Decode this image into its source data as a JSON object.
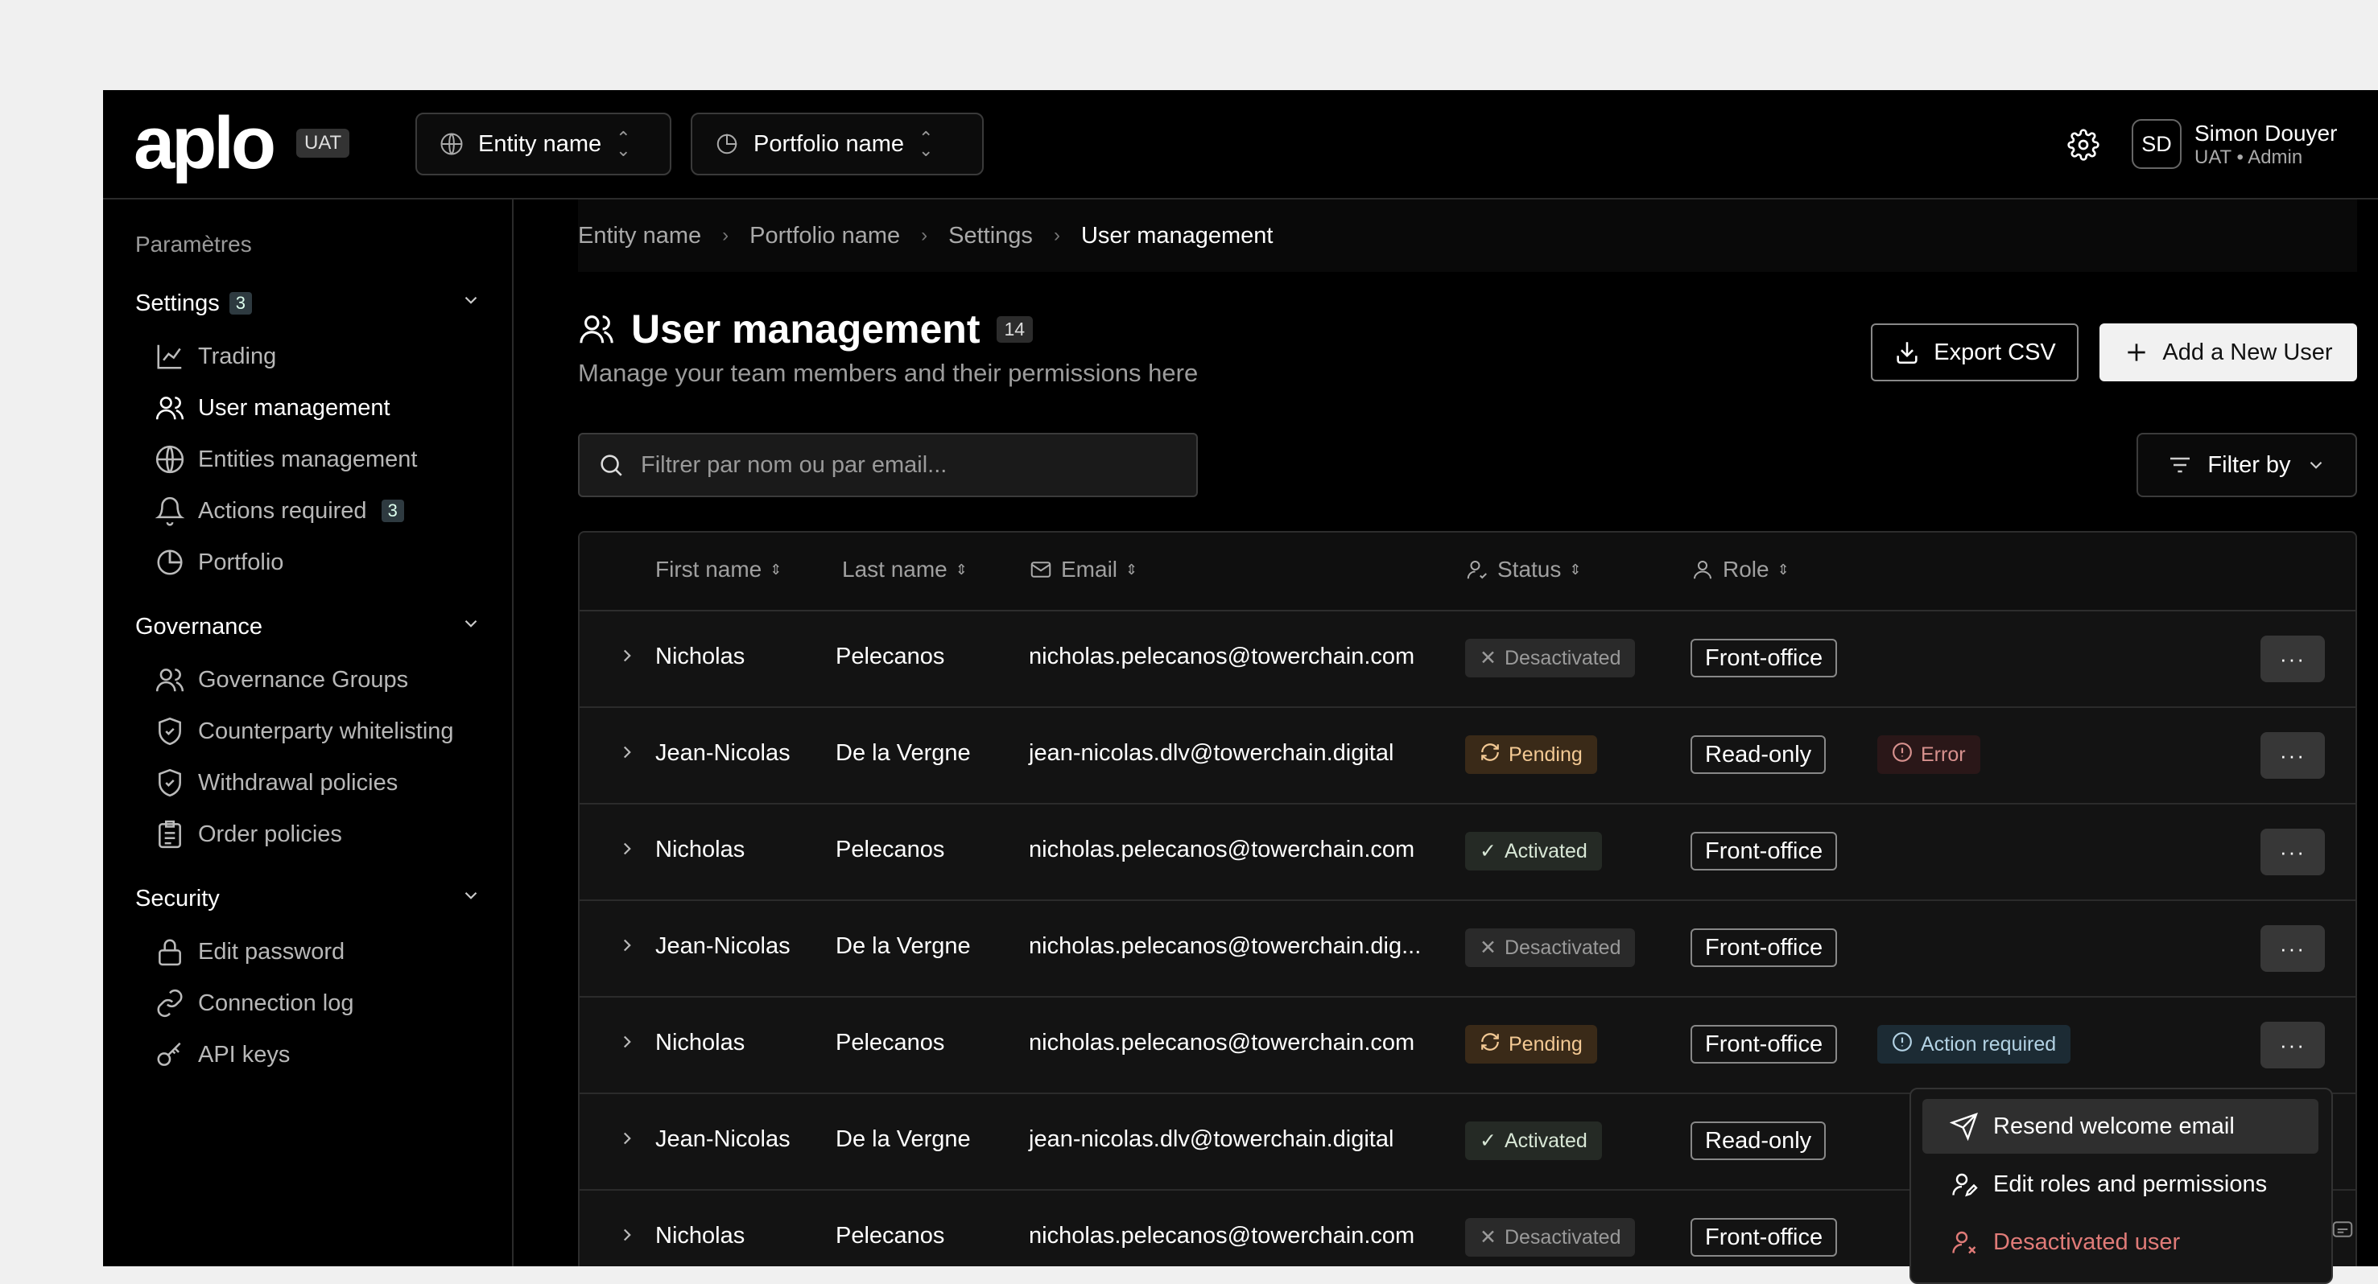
{
  "header": {
    "logo": "aplo",
    "env_badge": "UAT",
    "entity_selector": "Entity name",
    "portfolio_selector": "Portfolio name",
    "user": {
      "initials": "SD",
      "name": "Simon Douyer",
      "role": "UAT • Admin"
    }
  },
  "sidebar": {
    "title": "Paramètres",
    "sections": [
      {
        "label": "Settings",
        "count": "3",
        "items": [
          {
            "label": "Trading",
            "icon": "chart-line-icon"
          },
          {
            "label": "User management",
            "icon": "users-icon",
            "active": true
          },
          {
            "label": "Entities management",
            "icon": "globe-icon"
          },
          {
            "label": "Actions required",
            "icon": "bell-icon",
            "count": "3"
          },
          {
            "label": "Portfolio",
            "icon": "pie-chart-icon"
          }
        ]
      },
      {
        "label": "Governance",
        "items": [
          {
            "label": "Governance Groups",
            "icon": "users-icon"
          },
          {
            "label": "Counterparty whitelisting",
            "icon": "shield-check-icon"
          },
          {
            "label": "Withdrawal policies",
            "icon": "shield-check-icon"
          },
          {
            "label": "Order policies",
            "icon": "clipboard-list-icon"
          }
        ]
      },
      {
        "label": "Security",
        "items": [
          {
            "label": "Edit password",
            "icon": "lock-icon"
          },
          {
            "label": "Connection log",
            "icon": "link-icon"
          },
          {
            "label": "API keys",
            "icon": "key-icon"
          }
        ]
      }
    ]
  },
  "breadcrumb": [
    "Entity name",
    "Portfolio name",
    "Settings",
    "User management"
  ],
  "page": {
    "title": "User management",
    "count": "14",
    "subtitle": "Manage your team members and their permissions here",
    "export_label": "Export CSV",
    "add_label": "Add a New User",
    "search_placeholder": "Filtrer par nom ou par email...",
    "filter_label": "Filter by"
  },
  "table": {
    "columns": [
      "First name",
      "Last name",
      "Email",
      "Status",
      "Role"
    ],
    "rows": [
      {
        "first": "Nicholas",
        "last": "Pelecanos",
        "email": "nicholas.pelecanos@towerchain.com",
        "status": "Desactivated",
        "role": "Front-office",
        "extra": ""
      },
      {
        "first": "Jean-Nicolas",
        "last": "De la Vergne",
        "email": "jean-nicolas.dlv@towerchain.digital",
        "status": "Pending",
        "role": "Read-only",
        "extra": "Error"
      },
      {
        "first": "Nicholas",
        "last": "Pelecanos",
        "email": "nicholas.pelecanos@towerchain.com",
        "status": "Activated",
        "role": "Front-office",
        "extra": ""
      },
      {
        "first": "Jean-Nicolas",
        "last": "De la Vergne",
        "email": "nicholas.pelecanos@towerchain.dig...",
        "status": "Desactivated",
        "role": "Front-office",
        "extra": ""
      },
      {
        "first": "Nicholas",
        "last": "Pelecanos",
        "email": "nicholas.pelecanos@towerchain.com",
        "status": "Pending",
        "role": "Front-office",
        "extra": "Action required"
      },
      {
        "first": "Jean-Nicolas",
        "last": "De la Vergne",
        "email": "jean-nicolas.dlv@towerchain.digital",
        "status": "Activated",
        "role": "Read-only",
        "extra": ""
      },
      {
        "first": "Nicholas",
        "last": "Pelecanos",
        "email": "nicholas.pelecanos@towerchain.com",
        "status": "Desactivated",
        "role": "Front-office",
        "extra": ""
      }
    ]
  },
  "row_menu": {
    "items": [
      "Resend welcome email",
      "Edit roles and permissions",
      "Desactivated user"
    ]
  },
  "colors": {
    "accent": "#f1f1f1",
    "pending": "#f3c994",
    "error": "#d7918e",
    "info": "#b3d2e4",
    "danger": "#e07b78"
  }
}
